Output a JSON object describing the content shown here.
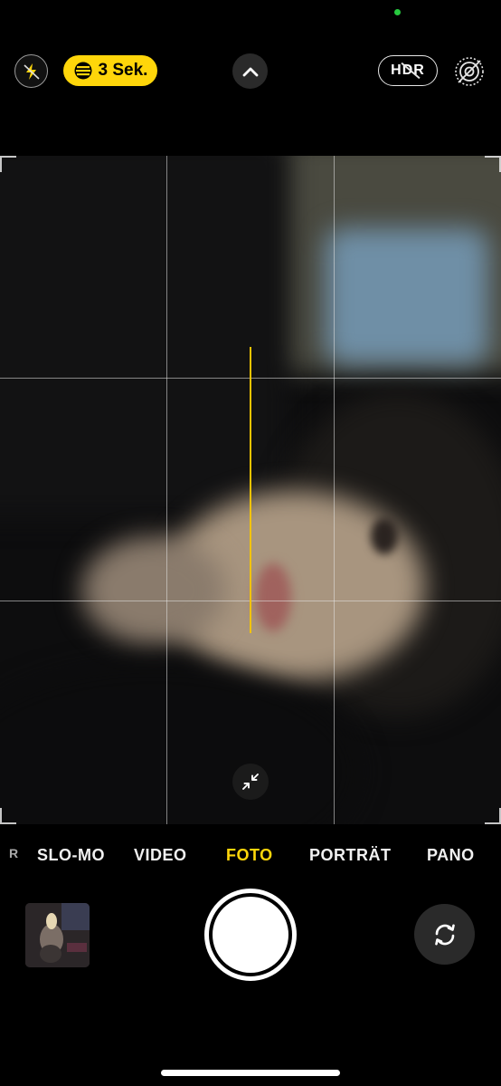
{
  "top_bar": {
    "flash_icon": "flash-off-icon",
    "timer_label": "3 Sek.",
    "timer_icon": "self-timer-icon",
    "controls_icon": "chevron-up-icon",
    "hdr_label": "HDR",
    "live_icon": "live-photo-off-icon"
  },
  "viewfinder": {
    "zoom_icon": "collapse-arrows-icon"
  },
  "modes": {
    "items": [
      "R",
      "SLO-MO",
      "VIDEO",
      "FOTO",
      "PORTRÄT",
      "PANO"
    ],
    "active": "FOTO"
  },
  "bottom": {
    "thumbnail_icon": "last-photo-thumbnail",
    "shutter_icon": "shutter-button",
    "flip_icon": "camera-flip-icon"
  },
  "colors": {
    "accent": "#ffd60a",
    "background": "#000000",
    "privacy_indicator": "#27c93f"
  }
}
